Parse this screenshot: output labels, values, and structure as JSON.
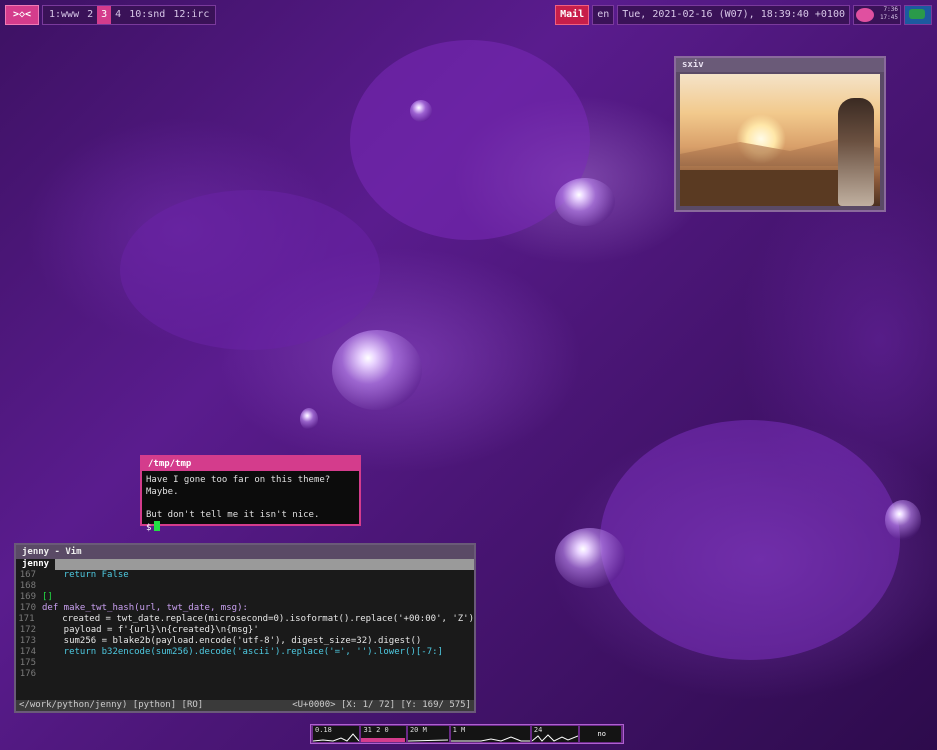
{
  "topbar": {
    "logo": ">◇<",
    "workspaces": [
      "1:www",
      "2",
      "3",
      "4",
      "10:snd",
      "12:irc"
    ],
    "active_workspace": "3",
    "mail": "Mail",
    "lang": "en",
    "datetime": "Tue, 2021-02-16 (W07), 18:39:40 +0100",
    "tray_time_top": "7:36",
    "tray_time_bottom": "17:45"
  },
  "sxiv": {
    "title": "sxiv"
  },
  "terminal": {
    "title": "/tmp/tmp",
    "lines": [
      "Have I gone too far on this theme? Maybe.",
      "",
      "But don't tell me it isn't nice."
    ],
    "prompt": "$"
  },
  "vim": {
    "title": "jenny - Vim",
    "tab": "jenny",
    "lines": [
      {
        "n": "167",
        "t": "    return False"
      },
      {
        "n": "168",
        "t": ""
      },
      {
        "n": "169",
        "t": "[]"
      },
      {
        "n": "170",
        "t": "def make_twt_hash(url, twt_date, msg):"
      },
      {
        "n": "171",
        "t": "    created = twt_date.replace(microsecond=0).isoformat().replace('+00:00', 'Z')"
      },
      {
        "n": "172",
        "t": "    payload = f'{url}\\n{created}\\n{msg}'"
      },
      {
        "n": "173",
        "t": "    sum256 = blake2b(payload.encode('utf-8'), digest_size=32).digest()"
      },
      {
        "n": "174",
        "t": "    return b32encode(sum256).decode('ascii').replace('=', '').lower()[-7:]"
      },
      {
        "n": "175",
        "t": ""
      },
      {
        "n": "176",
        "t": ""
      }
    ],
    "status_left": "</work/python/jenny) [python]  [RO]",
    "status_right": "<U+0000> [X:  1/ 72] [Y:  169/  575]"
  },
  "bottombar": {
    "cells": [
      "0.18",
      "31 2 0",
      "20 M",
      "1 M",
      "24",
      "no battery"
    ]
  },
  "colors": {
    "accent": "#d43c8c",
    "bar": "#6a2a88"
  }
}
